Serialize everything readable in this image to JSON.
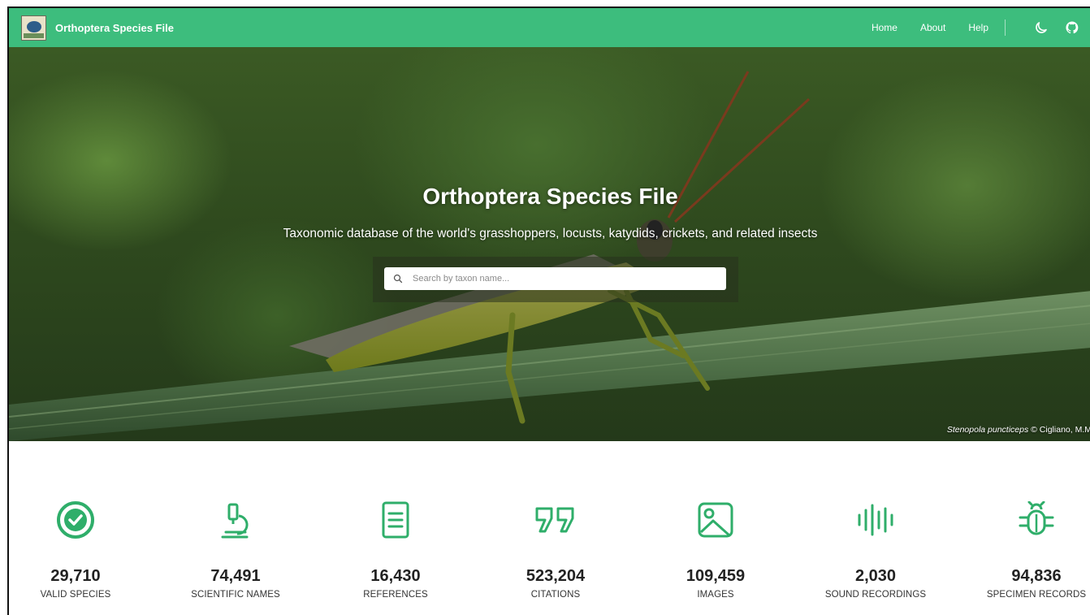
{
  "navbar": {
    "brand": "Orthoptera Species File",
    "links": [
      "Home",
      "About",
      "Help"
    ]
  },
  "hero": {
    "title": "Orthoptera Species File",
    "subtitle": "Taxonomic database of the world's grasshoppers, locusts, katydids, crickets, and related insects",
    "search_placeholder": "Search by taxon name...",
    "credit_species": "Stenopola puncticeps",
    "credit_rest": " © Cigliano, M.M"
  },
  "stats": [
    {
      "value": "29,710",
      "label": "VALID SPECIES",
      "icon": "check-circle-icon"
    },
    {
      "value": "74,491",
      "label": "SCIENTIFIC NAMES",
      "icon": "microscope-icon"
    },
    {
      "value": "16,430",
      "label": "REFERENCES",
      "icon": "document-icon"
    },
    {
      "value": "523,204",
      "label": "CITATIONS",
      "icon": "quote-icon"
    },
    {
      "value": "109,459",
      "label": "IMAGES",
      "icon": "image-icon"
    },
    {
      "value": "2,030",
      "label": "SOUND RECORDINGS",
      "icon": "waveform-icon"
    },
    {
      "value": "94,836",
      "label": "SPECIMEN RECORDS",
      "icon": "bug-icon"
    }
  ],
  "colors": {
    "accent": "#3dbd7d",
    "icon_green": "#2fae6a"
  }
}
